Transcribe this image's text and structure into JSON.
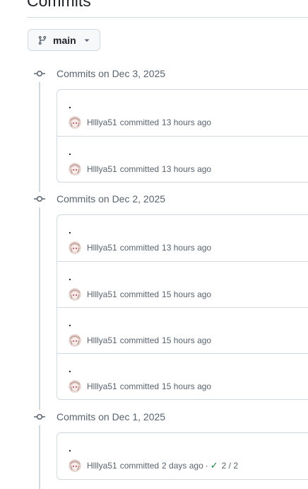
{
  "page": {
    "title": "Commits"
  },
  "branch": {
    "name": "main"
  },
  "groups": [
    {
      "title": "Commits on Dec 3, 2025",
      "commits": [
        {
          "message": ".",
          "author": "Hlllya51",
          "verb": "committed",
          "time": "13 hours ago"
        },
        {
          "message": ".",
          "author": "Hlllya51",
          "verb": "committed",
          "time": "13 hours ago"
        }
      ]
    },
    {
      "title": "Commits on Dec 2, 2025",
      "commits": [
        {
          "message": ".",
          "author": "Hlllya51",
          "verb": "committed",
          "time": "13 hours ago"
        },
        {
          "message": ".",
          "author": "Hlllya51",
          "verb": "committed",
          "time": "15 hours ago"
        },
        {
          "message": ".",
          "author": "Hlllya51",
          "verb": "committed",
          "time": "15 hours ago"
        },
        {
          "message": ".",
          "author": "Hlllya51",
          "verb": "committed",
          "time": "15 hours ago"
        }
      ]
    },
    {
      "title": "Commits on Dec 1, 2025",
      "commits": [
        {
          "message": ".",
          "author": "Hlllya51",
          "verb": "committed",
          "time": "2 days ago",
          "separator": "·",
          "checks": "2 / 2"
        }
      ]
    }
  ],
  "colors": {
    "success": "#1a7f37",
    "muted": "#59636e",
    "border": "#d1d9e0"
  }
}
